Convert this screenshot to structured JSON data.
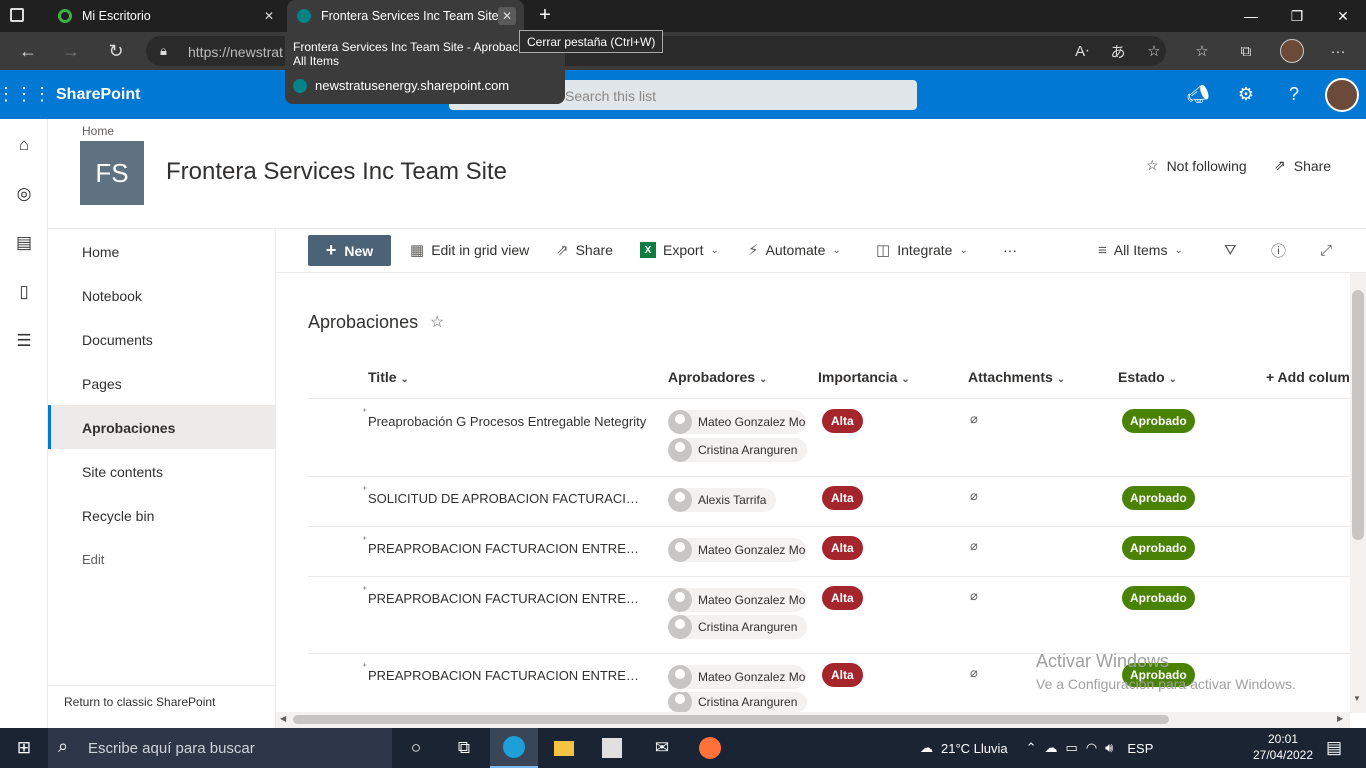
{
  "browser": {
    "tabs": [
      {
        "label": "Mi Escritorio"
      },
      {
        "label": "Frontera Services Inc Team Site - Aprobaciones - All Items"
      }
    ],
    "url": "https://newstrat",
    "tooltip": "Cerrar pestaña (Ctrl+W)",
    "hovercard": {
      "title": "Frontera Services Inc Team Site - Aprobaciones - All Items",
      "domain": "newstratusenergy.sharepoint.com"
    }
  },
  "sharepoint": {
    "app_name": "SharePoint",
    "search_placeholder": "Search this list"
  },
  "site": {
    "breadcrumb": "Home",
    "logo": "FS",
    "title": "Frontera Services Inc Team Site",
    "follow": "Not following",
    "share": "Share"
  },
  "nav": {
    "items": [
      "Home",
      "Notebook",
      "Documents",
      "Pages",
      "Aprobaciones",
      "Site contents",
      "Recycle bin"
    ],
    "edit": "Edit",
    "classic": "Return to classic SharePoint"
  },
  "commands": {
    "new": "New",
    "grid": "Edit in grid view",
    "share": "Share",
    "export": "Export",
    "automate": "Automate",
    "integrate": "Integrate",
    "more": "···",
    "view": "All Items"
  },
  "list": {
    "title": "Aprobaciones",
    "columns": [
      "Title",
      "Aprobadores",
      "Importancia",
      "Attachments",
      "Estado",
      "+ Add column"
    ],
    "rows": [
      {
        "title": "Preaprobación G Procesos Entregable Netegrity",
        "approvers": [
          "Mateo Gonzalez Montoya",
          "Cristina Aranguren"
        ],
        "importance": "Alta",
        "status": "Aprobado"
      },
      {
        "title": "SOLICITUD DE APROBACION FACTURACION ENTREGABLE",
        "approvers": [
          "Alexis Tarrifa"
        ],
        "importance": "Alta",
        "status": "Aprobado"
      },
      {
        "title": "PREAPROBACION FACTURACION ENTREGABLE",
        "approvers": [
          "Mateo Gonzalez Montoya"
        ],
        "importance": "Alta",
        "status": "Aprobado"
      },
      {
        "title": "PREAPROBACION FACTURACION ENTREGABLE",
        "approvers": [
          "Mateo Gonzalez Montoya",
          "Cristina Aranguren"
        ],
        "importance": "Alta",
        "status": "Aprobado"
      },
      {
        "title": "PREAPROBACION FACTURACION ENTREGABLE",
        "approvers": [
          "Mateo Gonzalez Montoya",
          "Cristina Aranguren"
        ],
        "importance": "Alta",
        "status": "Aprobado"
      }
    ]
  },
  "watermark": {
    "line1": "Activar Windows",
    "line2": "Ve a Configuración para activar Windows."
  },
  "taskbar": {
    "search_placeholder": "Escribe aquí para buscar",
    "weather": "21°C  Lluvia",
    "lang": "ESP",
    "time": "20:01",
    "date": "27/04/2022"
  },
  "colors": {
    "sharepoint_blue": "#0078d4",
    "alta": "#a4262c",
    "aprobado": "#498205",
    "new_button": "#4c6277"
  }
}
